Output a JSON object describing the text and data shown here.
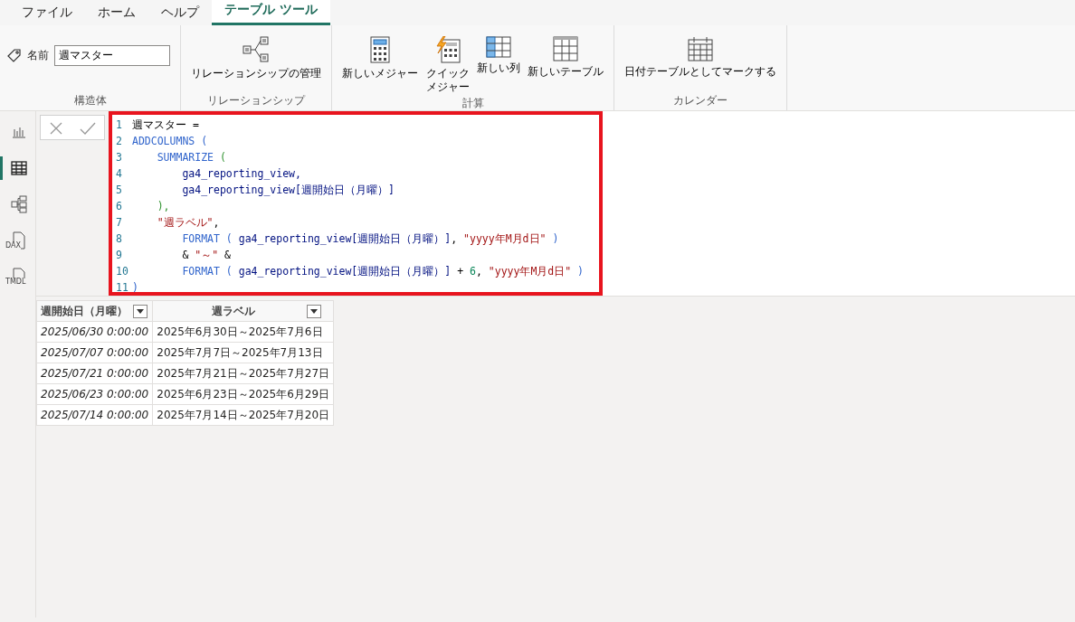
{
  "tabs": [
    {
      "label": "ファイル",
      "selected": false
    },
    {
      "label": "ホーム",
      "selected": false
    },
    {
      "label": "ヘルプ",
      "selected": false
    },
    {
      "label": "テーブル ツール",
      "selected": true
    }
  ],
  "ribbon": {
    "groups": [
      {
        "label": "構造体",
        "name_field": {
          "label": "名前",
          "value": "週マスター"
        }
      },
      {
        "label": "リレーションシップ",
        "buttons": [
          {
            "kind": "relations",
            "label": "リレーションシップの管理"
          }
        ]
      },
      {
        "label": "計算",
        "buttons": [
          {
            "kind": "measure",
            "label": "新しいメジャー"
          },
          {
            "kind": "quick",
            "label": "クイックメジャー"
          },
          {
            "kind": "column",
            "label": "新しい列"
          },
          {
            "kind": "table",
            "label": "新しいテーブル"
          }
        ]
      },
      {
        "label": "カレンダー",
        "buttons": [
          {
            "kind": "calendar",
            "label": "日付テーブルとしてマークする"
          }
        ]
      }
    ]
  },
  "sidebar": {
    "items": [
      {
        "kind": "report",
        "selected": false
      },
      {
        "kind": "table",
        "selected": true
      },
      {
        "kind": "model",
        "selected": false
      },
      {
        "kind": "dax",
        "label": "DAX",
        "selected": false
      },
      {
        "kind": "tmdl",
        "label": "TMDL",
        "selected": false
      }
    ]
  },
  "formula": {
    "lines": [
      {
        "number": "1",
        "tokens": [
          {
            "kind": "plain",
            "text": "週マスター ="
          }
        ]
      },
      {
        "number": "2",
        "tokens": [
          {
            "kind": "func",
            "text": "ADDCOLUMNS"
          },
          {
            "kind": "paren1",
            "text": " ("
          }
        ]
      },
      {
        "number": "3",
        "tokens": [
          {
            "kind": "func",
            "text": "    SUMMARIZE"
          },
          {
            "kind": "paren2",
            "text": " ("
          }
        ]
      },
      {
        "number": "4",
        "tokens": [
          {
            "kind": "ident",
            "text": "        ga4_reporting_view,"
          }
        ]
      },
      {
        "number": "5",
        "tokens": [
          {
            "kind": "ident",
            "text": "        ga4_reporting_view"
          },
          {
            "kind": "column",
            "text": "[週開始日（月曜）]"
          }
        ]
      },
      {
        "number": "6",
        "tokens": [
          {
            "kind": "paren2",
            "text": "    ),"
          }
        ]
      },
      {
        "number": "7",
        "tokens": [
          {
            "kind": "string",
            "text": "    \"週ラベル\""
          },
          {
            "kind": "plain",
            "text": ","
          }
        ]
      },
      {
        "number": "8",
        "tokens": [
          {
            "kind": "func",
            "text": "        FORMAT"
          },
          {
            "kind": "paren3",
            "text": " ( "
          },
          {
            "kind": "ident",
            "text": "ga4_reporting_view"
          },
          {
            "kind": "column",
            "text": "[週開始日（月曜）]"
          },
          {
            "kind": "plain",
            "text": ", "
          },
          {
            "kind": "string",
            "text": "\"yyyy年M月d日\""
          },
          {
            "kind": "paren3",
            "text": " )"
          }
        ]
      },
      {
        "number": "9",
        "tokens": [
          {
            "kind": "plain",
            "text": "        & "
          },
          {
            "kind": "string",
            "text": "\"～\""
          },
          {
            "kind": "plain",
            "text": " &"
          }
        ]
      },
      {
        "number": "10",
        "tokens": [
          {
            "kind": "func",
            "text": "        FORMAT"
          },
          {
            "kind": "paren3",
            "text": " ( "
          },
          {
            "kind": "ident",
            "text": "ga4_reporting_view"
          },
          {
            "kind": "column",
            "text": "[週開始日（月曜）]"
          },
          {
            "kind": "plain",
            "text": " + "
          },
          {
            "kind": "number",
            "text": "6"
          },
          {
            "kind": "plain",
            "text": ", "
          },
          {
            "kind": "string",
            "text": "\"yyyy年M月d日\""
          },
          {
            "kind": "paren3",
            "text": " )"
          }
        ]
      },
      {
        "number": "11",
        "tokens": [
          {
            "kind": "paren1",
            "text": ")"
          }
        ]
      }
    ]
  },
  "table": {
    "columns": [
      "週開始日（月曜）",
      "週ラベル"
    ],
    "rows": [
      [
        "2025/06/30 0:00:00",
        "2025年6月30日～2025年7月6日"
      ],
      [
        "2025/07/07 0:00:00",
        "2025年7月7日～2025年7月13日"
      ],
      [
        "2025/07/21 0:00:00",
        "2025年7月21日～2025年7月27日"
      ],
      [
        "2025/06/23 0:00:00",
        "2025年6月23日～2025年6月29日"
      ],
      [
        "2025/07/14 0:00:00",
        "2025年7月14日～2025年7月20日"
      ]
    ]
  }
}
